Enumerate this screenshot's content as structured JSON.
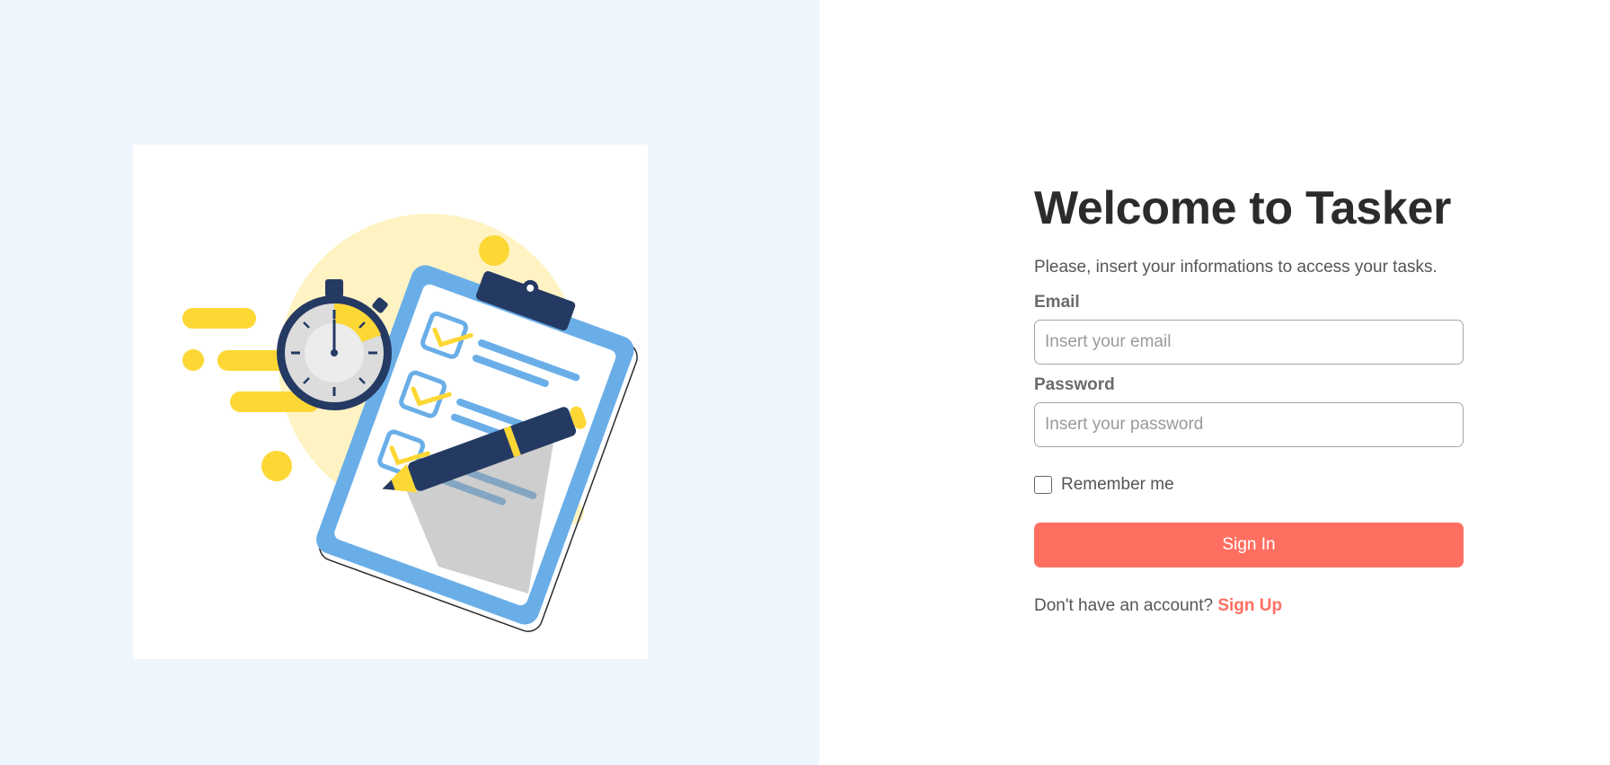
{
  "illustration": {
    "subject": "clipboard-checklist-with-stopwatch-and-pen"
  },
  "form": {
    "title": "Welcome to Tasker",
    "subtitle": "Please, insert your informations to access your tasks.",
    "email": {
      "label": "Email",
      "value": "",
      "placeholder": "Insert your email"
    },
    "password": {
      "label": "Password",
      "value": "",
      "placeholder": "Insert your password"
    },
    "remember": {
      "label": "Remember me",
      "checked": false
    },
    "sign_in_label": "Sign In",
    "signup_prompt": "Don't have an account?",
    "signup_link": "Sign Up"
  },
  "colors": {
    "accent": "#ff6f61",
    "left_background": "#eef6fd",
    "illustration_yellow": "#fdd835",
    "illustration_blue": "#6aaee8",
    "illustration_navy": "#253a63"
  }
}
